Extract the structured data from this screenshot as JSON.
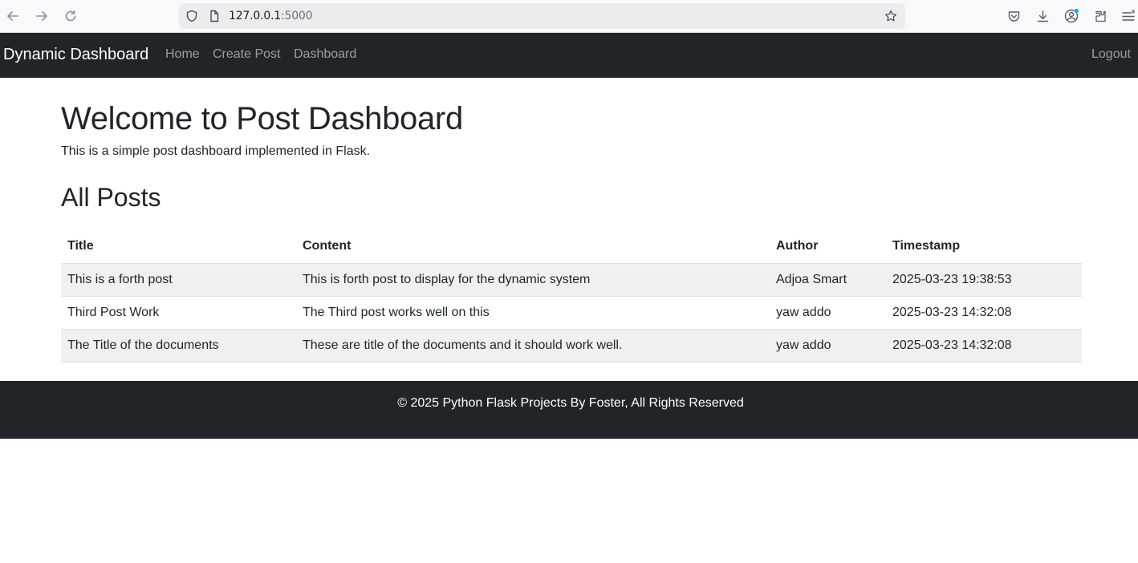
{
  "browser": {
    "url_host": "127.0.0.1",
    "url_port": ":5000"
  },
  "navbar": {
    "brand": "Dynamic Dashboard",
    "links": [
      "Home",
      "Create Post",
      "Dashboard"
    ],
    "logout": "Logout"
  },
  "main": {
    "heading": "Welcome to Post Dashboard",
    "subtitle": "This is a simple post dashboard implemented in Flask.",
    "section_title": "All Posts"
  },
  "table": {
    "headers": [
      "Title",
      "Content",
      "Author",
      "Timestamp"
    ],
    "rows": [
      [
        "This is a forth post",
        "This is forth post to display for the dynamic system",
        "Adjoa Smart",
        "2025-03-23 19:38:53"
      ],
      [
        "Third Post Work",
        "The Third post works well on this",
        "yaw addo",
        "2025-03-23 14:32:08"
      ],
      [
        "The Title of the documents",
        "These are title of the documents and it should work well.",
        "yaw addo",
        "2025-03-23 14:32:08"
      ]
    ]
  },
  "footer": {
    "text": "© 2025 Python Flask Projects By Foster, All Rights Reserved"
  },
  "icons": {
    "back": "arrow-left-icon",
    "forward": "arrow-right-icon",
    "reload": "reload-icon",
    "shield": "shield-icon",
    "page": "page-icon",
    "bookmark": "star-icon",
    "pocket": "pocket-icon",
    "download": "download-icon",
    "account": "account-icon",
    "extensions": "extensions-icon",
    "menu": "menu-icon"
  },
  "colors": {
    "navbar_bg": "#212529",
    "stripe_bg": "#f0f0f0",
    "text": "#212529"
  }
}
